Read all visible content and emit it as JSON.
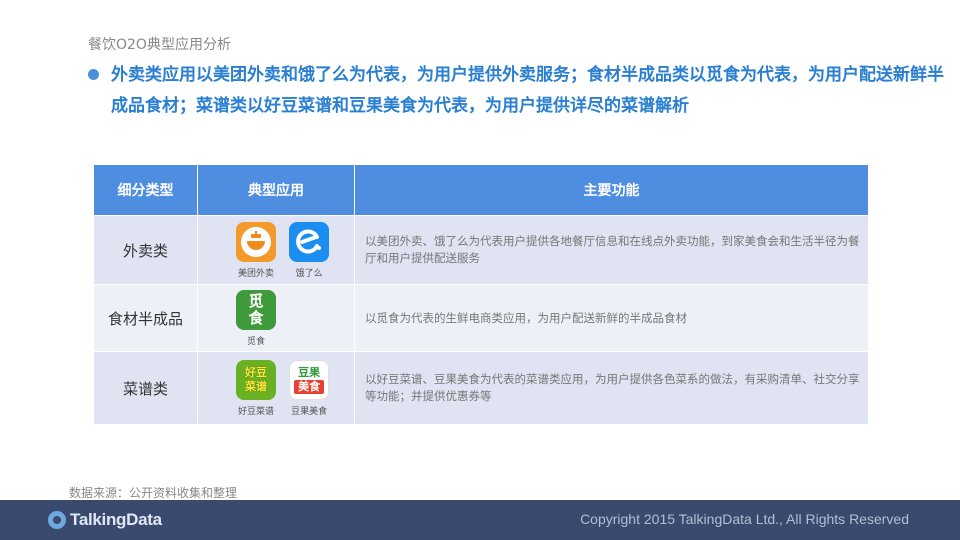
{
  "page_title": "餐饮O2O典型应用分析",
  "summary": "外卖类应用以美团外卖和饿了么为代表，为用户提供外卖服务；食材半成品类以觅食为代表，为用户配送新鲜半成品食材；菜谱类以好豆菜谱和豆果美食为代表，为用户提供详尽的菜谱解析",
  "table": {
    "headers": [
      "细分类型",
      "典型应用",
      "主要功能"
    ],
    "rows": [
      {
        "category": "外卖类",
        "apps": [
          {
            "name": "美团外卖",
            "icon": "meituan-waimai-icon",
            "color": "#f39a2b"
          },
          {
            "name": "饿了么",
            "icon": "eleme-icon",
            "color": "#1b8ef2"
          }
        ],
        "description": "以美团外卖、饿了么为代表用户提供各地餐厅信息和在线点外卖功能，到家美食会和生活半径为餐厅和用户提供配送服务"
      },
      {
        "category": "食材半成品",
        "apps": [
          {
            "name": "觅食",
            "icon": "mishi-icon",
            "color": "#3e9a3a",
            "glyphs": [
              "觅",
              "食"
            ]
          }
        ],
        "description": "以觅食为代表的生鲜电商类应用，为用户配送新鲜的半成品食材"
      },
      {
        "category": "菜谱类",
        "apps": [
          {
            "name": "好豆菜谱",
            "icon": "haodou-caipu-icon",
            "color": "#6ab023",
            "glyphs": [
              "好豆",
              "菜谱"
            ]
          },
          {
            "name": "豆果美食",
            "icon": "douguo-meishi-icon",
            "color": "#ffffff",
            "glyphs": [
              "豆果",
              "美食"
            ]
          }
        ],
        "description": "以好豆菜谱、豆果美食为代表的菜谱类应用，为用户提供各色菜系的做法，有采购清单、社交分享等功能；并提供优惠券等"
      }
    ]
  },
  "source_note": "数据来源：公开资料收集和整理",
  "footer": {
    "logo": "TalkingData",
    "copyright": "Copyright 2015 TalkingData Ltd., All Rights Reserved"
  },
  "colors": {
    "accent": "#2a7fd1",
    "header": "#4e8de0",
    "footer": "#3a4a6f"
  }
}
